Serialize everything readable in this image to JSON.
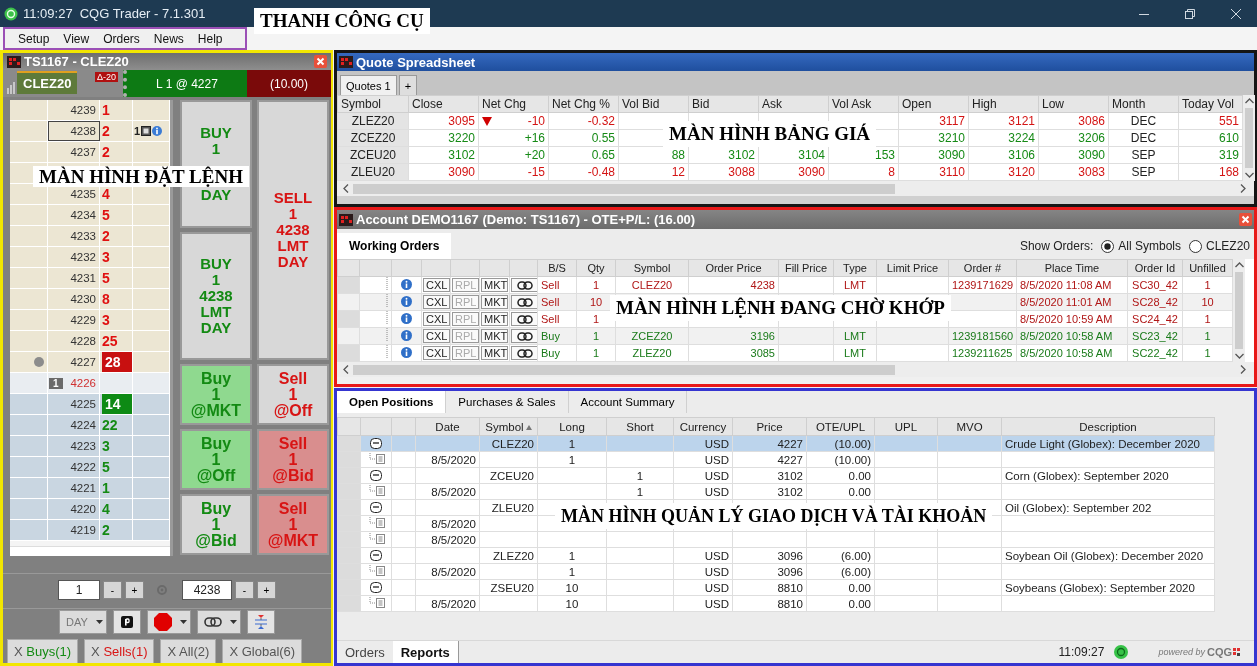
{
  "window": {
    "time": "11:09:27",
    "title": "CQG Trader - 7.1.301"
  },
  "menu_bar": {
    "items": [
      "Setup",
      "View",
      "Orders",
      "News",
      "Help"
    ],
    "annotation": "THANH CÔNG CỤ"
  },
  "order_panel": {
    "title": "TS1167 - CLEZ20",
    "symbol_tab": "CLEZ20",
    "delta_badge": "Δ-20",
    "position": "L 1 @ 4227",
    "pnl": "(10.00)",
    "annotation": "MÀN HÌNH ĐẶT LỆNH",
    "ladder": [
      {
        "kind": "ask",
        "price": "4239",
        "volume": "1"
      },
      {
        "kind": "ask",
        "price": "4238",
        "volume": "2",
        "outlined": true,
        "working_orders": "1"
      },
      {
        "kind": "ask",
        "price": "4237",
        "volume": "2"
      },
      {
        "kind": "ask"
      },
      {
        "kind": "ask",
        "price": "4235",
        "volume": "4"
      },
      {
        "kind": "ask",
        "price": "4234",
        "volume": "5"
      },
      {
        "kind": "ask",
        "price": "4233",
        "volume": "2"
      },
      {
        "kind": "ask",
        "price": "4232",
        "volume": "3"
      },
      {
        "kind": "ask",
        "price": "4231",
        "volume": "5"
      },
      {
        "kind": "ask",
        "price": "4230",
        "volume": "8"
      },
      {
        "kind": "ask",
        "price": "4229",
        "volume": "3"
      },
      {
        "kind": "ask",
        "price": "4228",
        "volume": "25"
      },
      {
        "kind": "ask",
        "price": "4227",
        "volume": "28",
        "best": true,
        "last_trade": true
      },
      {
        "kind": "spread",
        "price": "4226",
        "position_flag": "1"
      },
      {
        "kind": "bid",
        "price": "4225",
        "volume": "14",
        "best": true
      },
      {
        "kind": "bid",
        "price": "4224",
        "volume": "22"
      },
      {
        "kind": "bid",
        "price": "4223",
        "volume": "3"
      },
      {
        "kind": "bid",
        "price": "4222",
        "volume": "5"
      },
      {
        "kind": "bid",
        "price": "4221",
        "volume": "1"
      },
      {
        "kind": "bid",
        "price": "4220",
        "volume": "4"
      },
      {
        "kind": "bid",
        "price": "4219",
        "volume": "2"
      }
    ],
    "limit_buttons": {
      "buy": [
        {
          "lines": [
            "BUY",
            "1",
            "DAY"
          ]
        },
        {
          "lines": [
            "BUY",
            "1",
            "4238",
            "LMT",
            "DAY"
          ]
        }
      ],
      "sell": [
        {
          "lines": [
            "SELL",
            "1",
            "4238",
            "LMT",
            "DAY"
          ]
        }
      ]
    },
    "market_buttons": [
      [
        {
          "kind": "buy",
          "color": "#8fd98f",
          "lines": [
            "Buy",
            "1",
            "@MKT"
          ]
        },
        {
          "kind": "sell",
          "color": "#d8d8d8",
          "lines": [
            "Sell",
            "1",
            "@Off"
          ]
        }
      ],
      [
        {
          "kind": "buy",
          "color": "#8fd98f",
          "lines": [
            "Buy",
            "1",
            "@Off"
          ]
        },
        {
          "kind": "sell",
          "color": "#d98e8e",
          "lines": [
            "Sell",
            "1",
            "@Bid"
          ]
        }
      ],
      [
        {
          "kind": "buy",
          "color": "#d8d8d8",
          "lines": [
            "Buy",
            "1",
            "@Bid"
          ]
        },
        {
          "kind": "sell",
          "color": "#d98e8e",
          "lines": [
            "Sell",
            "1",
            "@MKT"
          ]
        }
      ]
    ],
    "quantity": "1",
    "minus": "-",
    "plus": "+",
    "price": "4238",
    "duration": "DAY",
    "cancel_tabs": [
      {
        "close": "X",
        "label": "Buys(1)",
        "kind": "buy"
      },
      {
        "close": "X",
        "label": "Sells(1)",
        "kind": "sell"
      },
      {
        "close": "X",
        "label": "All(2)",
        "kind": "all"
      },
      {
        "close": "X",
        "label": "Global(6)",
        "kind": "all"
      }
    ]
  },
  "quote_spreadsheet": {
    "title": "Quote Spreadsheet",
    "annotation": "MÀN HÌNH BẢNG GIÁ",
    "tabs": [
      {
        "label": "Quotes 1",
        "selected": true
      }
    ],
    "add_tab": "+",
    "columns": [
      "Symbol",
      "Close",
      "Net Chg",
      "Net Chg %",
      "Vol Bid",
      "Bid",
      "Ask",
      "Vol Ask",
      "Open",
      "High",
      "Low",
      "Month",
      "Today Vol"
    ],
    "rows": [
      {
        "kind": "down",
        "down_arrow": true,
        "symbol": "ZLEZ20",
        "close": "3095",
        "net_chg": "-10",
        "net_chg_pct": "-0.32",
        "open": "3117",
        "high": "3121",
        "low": "3086",
        "month": "DEC",
        "today_vol": "551"
      },
      {
        "kind": "up",
        "down_arrow": false,
        "symbol": "ZCEZ20",
        "close": "3220",
        "net_chg": "+16",
        "net_chg_pct": "0.55",
        "open": "3210",
        "high": "3224",
        "low": "3206",
        "month": "DEC",
        "today_vol": "610"
      },
      {
        "kind": "up",
        "down_arrow": false,
        "symbol": "ZCEU20",
        "close": "3102",
        "net_chg": "+20",
        "net_chg_pct": "0.65",
        "vol_bid": "88",
        "bid": "3102",
        "ask": "3104",
        "vol_ask": "153",
        "open": "3090",
        "high": "3106",
        "low": "3090",
        "month": "SEP",
        "today_vol": "319"
      },
      {
        "kind": "down",
        "down_arrow": false,
        "symbol": "ZLEU20",
        "close": "3090",
        "net_chg": "-15",
        "net_chg_pct": "-0.48",
        "vol_bid": "12",
        "bid": "3088",
        "ask": "3090",
        "vol_ask": "8",
        "open": "3110",
        "high": "3120",
        "low": "3083",
        "month": "SEP",
        "today_vol": "168"
      }
    ]
  },
  "account": {
    "title": "Account DEMO1167 (Demo: TS1167) - OTE+P/L: (16.00)",
    "annotation": "MÀN HÌNH LỆNH ĐANG CHỜ KHỚP",
    "tabs": [
      {
        "label": "Working Orders",
        "selected": true
      }
    ],
    "show_orders_label": "Show Orders:",
    "filters": [
      {
        "label": "All Symbols",
        "selected": true
      },
      {
        "label": "CLEZ20",
        "selected": false
      }
    ],
    "columns": [
      "B/S",
      "Qty",
      "Symbol",
      "Order Price",
      "Fill Price",
      "Type",
      "Limit Price",
      "Order #",
      "Place Time",
      "Order Id",
      "Unfilled"
    ],
    "rows": [
      {
        "kind": "sell",
        "actions": [
          {
            "label": "CXL",
            "disabled": false
          },
          {
            "label": "RPL",
            "disabled": true
          },
          {
            "label": "MKT",
            "disabled": false
          }
        ],
        "bs": "Sell",
        "qty": "1",
        "symbol": "CLEZ20",
        "order_price": "4238",
        "type": "LMT",
        "order_no": "1239171629",
        "place_time": "8/5/2020 11:08 AM",
        "order_id": "SC30_42",
        "unfilled": "1"
      },
      {
        "kind": "sell",
        "actions": [
          {
            "label": "CXL",
            "disabled": false
          },
          {
            "label": "RPL",
            "disabled": true
          },
          {
            "label": "MKT",
            "disabled": false
          }
        ],
        "bs": "Sell",
        "qty": "10",
        "place_time": "8/5/2020 11:01 AM",
        "order_id": "SC28_42",
        "unfilled": "10"
      },
      {
        "kind": "sell",
        "actions": [
          {
            "label": "CXL",
            "disabled": false
          },
          {
            "label": "RPL",
            "disabled": true
          },
          {
            "label": "MKT",
            "disabled": false
          }
        ],
        "bs": "Sell",
        "qty": "1",
        "place_time": "8/5/2020 10:59 AM",
        "order_id": "SC24_42",
        "unfilled": "1"
      },
      {
        "kind": "buy",
        "actions": [
          {
            "label": "CXL",
            "disabled": false
          },
          {
            "label": "RPL",
            "disabled": true
          },
          {
            "label": "MKT",
            "disabled": false
          }
        ],
        "bs": "Buy",
        "qty": "1",
        "symbol": "ZCEZ20",
        "order_price": "3196",
        "type": "LMT",
        "order_no": "1239181560",
        "place_time": "8/5/2020 10:58 AM",
        "order_id": "SC23_42",
        "unfilled": "1"
      },
      {
        "kind": "buy",
        "actions": [
          {
            "label": "CXL",
            "disabled": false
          },
          {
            "label": "RPL",
            "disabled": true
          },
          {
            "label": "MKT",
            "disabled": false
          }
        ],
        "bs": "Buy",
        "qty": "1",
        "symbol": "ZLEZ20",
        "order_price": "3085",
        "type": "LMT",
        "order_no": "1239211625",
        "place_time": "8/5/2020 10:58 AM",
        "order_id": "SC22_42",
        "unfilled": "1"
      }
    ]
  },
  "positions": {
    "annotation": "MÀN HÌNH QUẢN LÝ GIAO DỊCH VÀ TÀI KHOẢN",
    "tabs": [
      {
        "label": "Open Positions",
        "selected": true
      },
      {
        "label": "Purchases & Sales",
        "selected": false
      },
      {
        "label": "Account Summary",
        "selected": false
      }
    ],
    "columns": [
      {
        "label": "Date",
        "sorted": false
      },
      {
        "label": "Symbol",
        "sorted": true
      },
      {
        "label": "Long",
        "sorted": false
      },
      {
        "label": "Short",
        "sorted": false
      },
      {
        "label": "Currency",
        "sorted": false
      },
      {
        "label": "Price",
        "sorted": false
      },
      {
        "label": "OTE/UPL",
        "sorted": false
      },
      {
        "label": "UPL",
        "sorted": false
      },
      {
        "label": "MVO",
        "sorted": false
      },
      {
        "label": "Description",
        "sorted": false
      }
    ],
    "rows": [
      {
        "expanded": true,
        "selected": true,
        "symbol": "CLEZ20",
        "long": "1",
        "currency": "USD",
        "price": "4227",
        "ote_upl": "(10.00)",
        "description": "Crude Light (Globex): December 2020",
        "children": [
          {
            "selected": false,
            "date": "8/5/2020",
            "long": "1",
            "currency": "USD",
            "price": "4227",
            "ote_upl": "(10.00)"
          }
        ]
      },
      {
        "expanded": true,
        "selected": false,
        "symbol": "ZCEU20",
        "short": "1",
        "currency": "USD",
        "price": "3102",
        "ote_upl": "0.00",
        "description": "Corn (Globex): September 2020",
        "children": [
          {
            "selected": false,
            "date": "8/5/2020",
            "short": "1",
            "currency": "USD",
            "price": "3102",
            "ote_upl": "0.00"
          }
        ]
      },
      {
        "expanded": true,
        "selected": false,
        "symbol": "ZLEU20",
        "description": "Oil (Globex): September 202",
        "children": [
          {
            "selected": false,
            "date": "8/5/2020"
          },
          {
            "selected": false,
            "date": "8/5/2020"
          }
        ]
      },
      {
        "expanded": true,
        "selected": false,
        "symbol": "ZLEZ20",
        "long": "1",
        "currency": "USD",
        "price": "3096",
        "ote_upl": "(6.00)",
        "description": "Soybean Oil (Globex): December 2020",
        "children": [
          {
            "selected": false,
            "date": "8/5/2020",
            "long": "1",
            "currency": "USD",
            "price": "3096",
            "ote_upl": "(6.00)"
          }
        ]
      },
      {
        "expanded": true,
        "selected": false,
        "symbol": "ZSEU20",
        "long": "10",
        "currency": "USD",
        "price": "8810",
        "ote_upl": "0.00",
        "description": "Soybeans (Globex): September 2020",
        "children": [
          {
            "selected": false,
            "date": "8/5/2020",
            "long": "10",
            "currency": "USD",
            "price": "8810",
            "ote_upl": "0.00"
          }
        ]
      }
    ]
  },
  "footer": {
    "tabs": [
      {
        "label": "Orders",
        "selected": false
      },
      {
        "label": "Reports",
        "selected": true
      }
    ],
    "time": "11:09:27",
    "powered_by": "powered by",
    "brand": "CQG"
  }
}
